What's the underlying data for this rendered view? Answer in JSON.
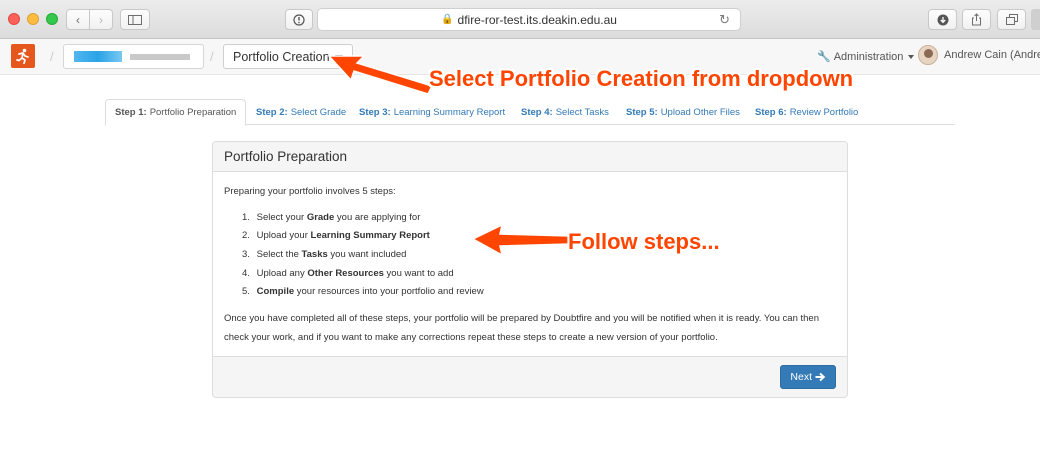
{
  "browser": {
    "url": "dfire-ror-test.its.deakin.edu.au",
    "icons": {
      "back": "chevron-left-icon",
      "forward": "chevron-right-icon",
      "sidebar": "sidebar-icon",
      "reader": "reader-icon",
      "lock": "lock-icon",
      "reload": "reload-icon",
      "download": "download-icon",
      "share": "share-icon",
      "tabs": "tabs-icon"
    }
  },
  "navbar": {
    "portfolio_label": "Portfolio Creation",
    "admin_label": "Administration",
    "user_label": "Andrew Cain (Andrew)"
  },
  "steps": [
    {
      "prefix": "Step 1:",
      "label": "Portfolio Preparation"
    },
    {
      "prefix": "Step 2:",
      "label": "Select Grade"
    },
    {
      "prefix": "Step 3:",
      "label": "Learning Summary Report"
    },
    {
      "prefix": "Step 4:",
      "label": "Select Tasks"
    },
    {
      "prefix": "Step 5:",
      "label": "Upload Other Files"
    },
    {
      "prefix": "Step 6:",
      "label": "Review Portfolio"
    }
  ],
  "panel": {
    "title": "Portfolio Preparation",
    "intro": "Preparing your portfolio involves 5 steps:",
    "list": [
      {
        "num": "1.",
        "pre": "Select your ",
        "bold": "Grade",
        "post": " you are applying for"
      },
      {
        "num": "2.",
        "pre": "Upload your ",
        "bold": "Learning Summary Report",
        "post": ""
      },
      {
        "num": "3.",
        "pre": "Select the ",
        "bold": "Tasks",
        "post": " you want included"
      },
      {
        "num": "4.",
        "pre": "Upload any ",
        "bold": "Other Resources",
        "post": " you want to add"
      },
      {
        "num": "5.",
        "pre": "",
        "bold": "Compile",
        "post": " your resources into your portfolio and review"
      }
    ],
    "outro": "Once you have completed all of these steps, your portfolio will be prepared by Doubtfire and you will be notified when it is ready. You can then check your work, and if you want to make any corrections repeat these steps to create a new version of your portfolio.",
    "next_label": "Next"
  },
  "annotations": {
    "select_text": "Select Portfolio Creation from dropdown",
    "follow_text": "Follow steps...",
    "color": "#ff4500"
  }
}
